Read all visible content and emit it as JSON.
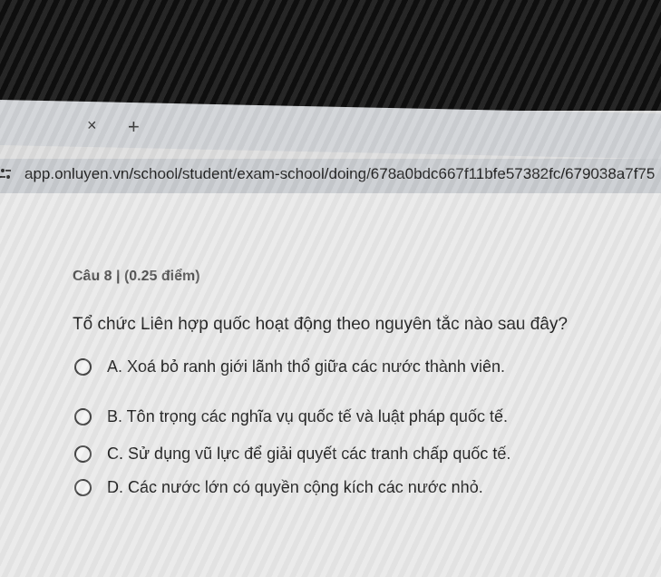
{
  "tabs": {
    "close_glyph": "×",
    "new_tab_glyph": "+"
  },
  "address_bar": {
    "url": "app.onluyen.vn/school/student/exam-school/doing/678a0bdc667f11bfe57382fc/679038a7f75"
  },
  "question": {
    "header": "Câu 8 | (0.25 điểm)",
    "text": "Tổ chức Liên hợp quốc hoạt động theo nguyên tắc nào sau đây?",
    "options": [
      {
        "label": "A. Xoá bỏ ranh giới lãnh thổ giữa các nước thành viên."
      },
      {
        "label": "B. Tôn trọng các nghĩa vụ quốc tế và luật pháp quốc tế."
      },
      {
        "label": "C. Sử dụng vũ lực để giải quyết các tranh chấp quốc tế."
      },
      {
        "label": "D. Các nước lớn có quyền cộng kích các nước nhỏ."
      }
    ]
  },
  "colors": {
    "bezel": "#0e0e0e",
    "page_background": "#e9e9e9",
    "text": "#222222"
  }
}
